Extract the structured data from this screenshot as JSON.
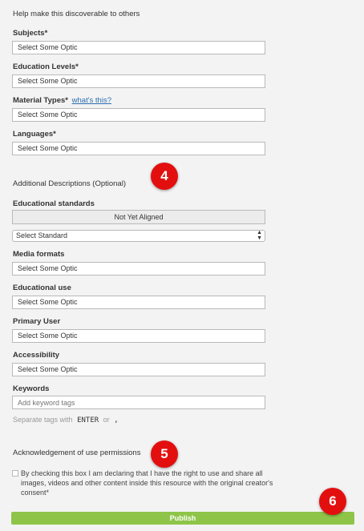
{
  "header": {
    "subtitle": "Help make this discoverable to others"
  },
  "fields": {
    "subjects": {
      "label": "Subjects*",
      "placeholder": "Select Some Optic"
    },
    "education_levels": {
      "label": "Education Levels*",
      "placeholder": "Select Some Optic"
    },
    "material_types": {
      "label": "Material Types*",
      "link": "what's this?",
      "placeholder": "Select Some Optic"
    },
    "languages": {
      "label": "Languages*",
      "placeholder": "Select Some Optic"
    }
  },
  "additional": {
    "title": "Additional Descriptions",
    "optional": "(Optional)",
    "educational_standards": {
      "label": "Educational standards",
      "status": "Not Yet Aligned",
      "select_value": "Select Standard"
    },
    "media_formats": {
      "label": "Media formats",
      "placeholder": "Select Some Optic"
    },
    "educational_use": {
      "label": "Educational use",
      "placeholder": "Select Some Optic"
    },
    "primary_user": {
      "label": "Primary User",
      "placeholder": "Select Some Optic"
    },
    "accessibility": {
      "label": "Accessibility",
      "placeholder": "Select Some Optic"
    },
    "keywords": {
      "label": "Keywords",
      "placeholder": "Add keyword tags",
      "hint_prefix": "Separate tags with",
      "hint_key": "ENTER",
      "hint_or": "or",
      "hint_comma": ","
    }
  },
  "acknowledgement": {
    "title": "Acknowledgement of use permissions",
    "text": "By checking this box I am declaring that I have the right to use and share all images, videos and other content inside this resource with the original creator's consent*",
    "checked": false
  },
  "publish": {
    "label": "Publish"
  },
  "callouts": [
    "4",
    "5",
    "6"
  ],
  "colors": {
    "publish_green": "#8ec549",
    "callout_red": "#e30f0f",
    "link_blue": "#2a6fb0"
  }
}
